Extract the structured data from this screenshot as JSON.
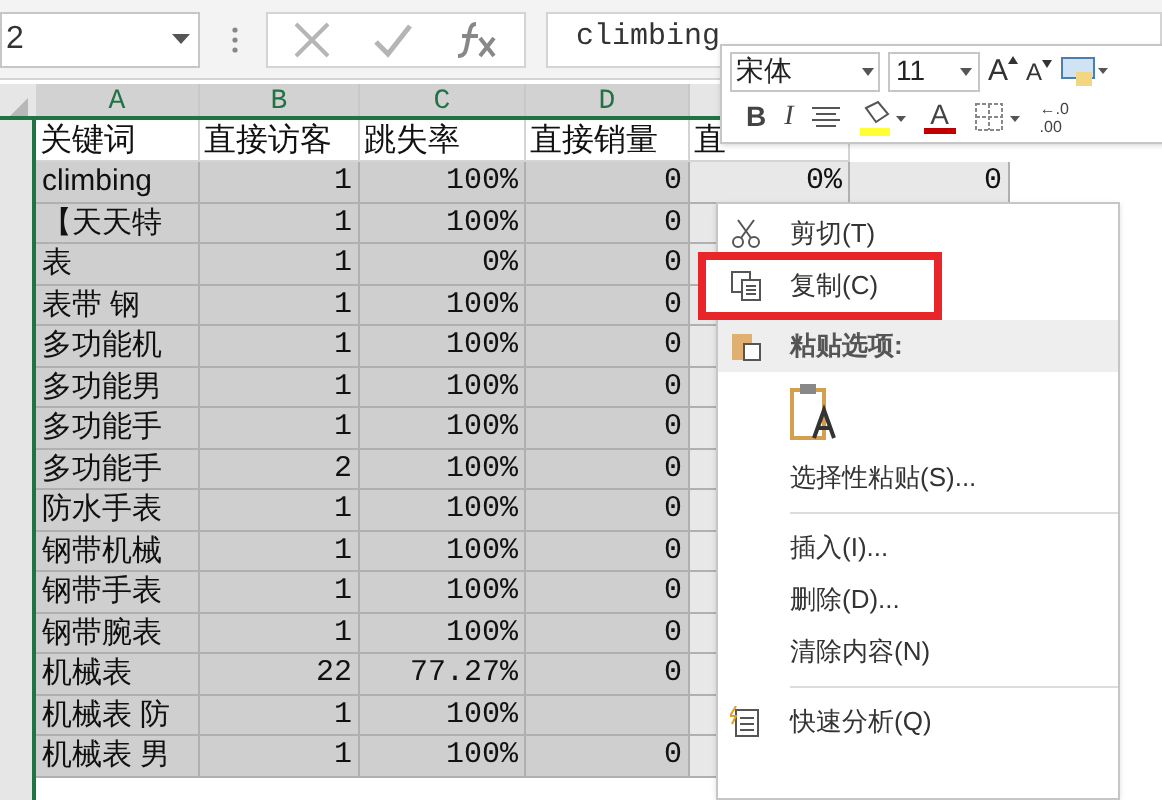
{
  "name_box": {
    "value": "2"
  },
  "formula_bar": {
    "value": "climbing"
  },
  "columns": [
    {
      "label": "A",
      "selected": true
    },
    {
      "label": "B",
      "selected": true
    },
    {
      "label": "C",
      "selected": true
    },
    {
      "label": "D",
      "selected": true
    }
  ],
  "header_row": [
    "关键词",
    "直接访客",
    "跳失率",
    "直接销量",
    "直"
  ],
  "rows": [
    {
      "cells": [
        "climbing",
        "1",
        "100%",
        "0",
        "0%",
        "0"
      ]
    },
    {
      "cells": [
        "【天天特",
        "1",
        "100%",
        "0"
      ]
    },
    {
      "cells": [
        "表",
        "1",
        "0%",
        "0"
      ]
    },
    {
      "cells": [
        "表带  钢",
        "1",
        "100%",
        "0"
      ]
    },
    {
      "cells": [
        "多功能机",
        "1",
        "100%",
        "0"
      ]
    },
    {
      "cells": [
        "多功能男",
        "1",
        "100%",
        "0"
      ]
    },
    {
      "cells": [
        "多功能手",
        "1",
        "100%",
        "0"
      ]
    },
    {
      "cells": [
        "多功能手",
        "2",
        "100%",
        "0"
      ]
    },
    {
      "cells": [
        "防水手表",
        "1",
        "100%",
        "0"
      ]
    },
    {
      "cells": [
        "钢带机械",
        "1",
        "100%",
        "0"
      ]
    },
    {
      "cells": [
        "钢带手表",
        "1",
        "100%",
        "0"
      ]
    },
    {
      "cells": [
        "钢带腕表",
        "1",
        "100%",
        "0"
      ]
    },
    {
      "cells": [
        "机械表",
        "22",
        "77.27%",
        "0"
      ]
    },
    {
      "cells": [
        "机械表  防",
        "1",
        "100%"
      ]
    },
    {
      "cells": [
        "机械表  男",
        "1",
        "100%",
        "0"
      ]
    }
  ],
  "mini_toolbar": {
    "font": "宋体",
    "size": "11",
    "grow": "A",
    "shrink": "A",
    "bold": "B",
    "italic": "I",
    "font_color": "A",
    "decimal": "←.0 .00"
  },
  "context_menu": [
    {
      "kind": "cut",
      "label": "剪切(T)",
      "highlighted": false
    },
    {
      "kind": "copy",
      "label": "复制(C)",
      "highlighted": true
    },
    {
      "kind": "header",
      "label": "粘贴选项:"
    },
    {
      "kind": "paste"
    },
    {
      "kind": "plain",
      "label": "选择性粘贴(S)...",
      "highlighted": false
    },
    {
      "kind": "separator"
    },
    {
      "kind": "plain",
      "label": "插入(I)...",
      "highlighted": false
    },
    {
      "kind": "plain",
      "label": "删除(D)...",
      "highlighted": false
    },
    {
      "kind": "plain",
      "label": "清除内容(N)",
      "highlighted": false
    },
    {
      "kind": "separator"
    },
    {
      "kind": "analysis",
      "label": "快速分析(Q)",
      "highlighted": false
    }
  ]
}
